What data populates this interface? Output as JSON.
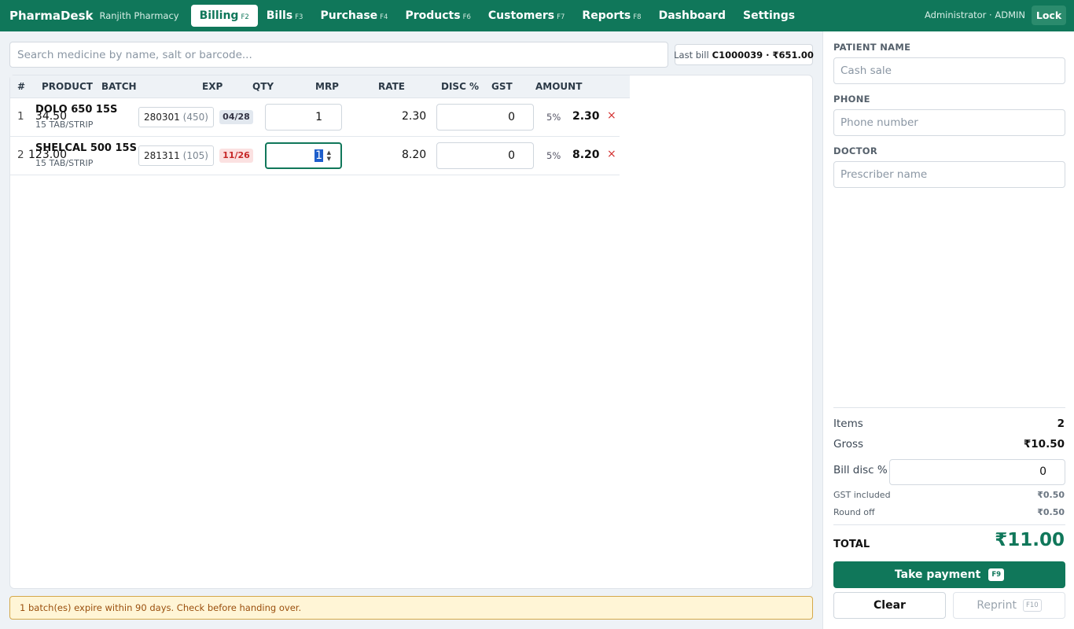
{
  "app": {
    "name": "PharmaDesk",
    "shop": "Ranjith Pharmacy"
  },
  "nav": [
    {
      "label": "Billing",
      "key": "F2"
    },
    {
      "label": "Bills",
      "key": "F3"
    },
    {
      "label": "Purchase",
      "key": "F4"
    },
    {
      "label": "Products",
      "key": "F6"
    },
    {
      "label": "Customers",
      "key": "F7"
    },
    {
      "label": "Reports",
      "key": "F8"
    },
    {
      "label": "Dashboard",
      "key": ""
    },
    {
      "label": "Settings",
      "key": ""
    }
  ],
  "user": "Administrator · ADMIN",
  "lock_label": "Lock",
  "search": {
    "placeholder": "Search medicine by name, salt or barcode..."
  },
  "last_bill": {
    "label": "Last bill",
    "value": "C1000039 · ₹651.00"
  },
  "table": {
    "headers": {
      "num": "#",
      "product": "PRODUCT",
      "batch": "BATCH",
      "exp": "EXP",
      "qty": "QTY",
      "mrp": "MRP",
      "rate": "RATE",
      "disc": "DISC %",
      "gst": "GST",
      "amount": "AMOUNT"
    },
    "rows": [
      {
        "num": "1",
        "product": "DOLO 650 15S",
        "pack": "15 TAB/STRIP",
        "batch": "280301",
        "stock": "(450)",
        "exp": "04/28",
        "qty": "1",
        "mrp": "34.50",
        "rate": "2.30",
        "disc": "0",
        "gst": "5%",
        "amount": "2.30",
        "delete": "×"
      },
      {
        "num": "2",
        "product": "SHELCAL 500 15S",
        "pack": "15 TAB/STRIP",
        "batch": "281311",
        "stock": "(105)",
        "exp": "11/26",
        "qty": "1",
        "mrp": "123.00",
        "rate": "8.20",
        "disc": "0",
        "gst": "5%",
        "amount": "8.20",
        "delete": "×"
      }
    ]
  },
  "alert": "1 batch(es) expire within 90 days. Check before handing over.",
  "patient": {
    "name_label": "PATIENT NAME",
    "name_placeholder": "Cash sale",
    "phone_label": "PHONE",
    "phone_placeholder": "Phone number",
    "doctor_label": "DOCTOR",
    "doctor_placeholder": "Prescriber name"
  },
  "summary": {
    "items_label": "Items",
    "items": "2",
    "gross_label": "Gross",
    "gross": "₹10.50",
    "bill_disc_label": "Bill disc %",
    "bill_disc": "0",
    "gst_label": "GST included",
    "gst": "₹0.50",
    "round_label": "Round off",
    "round": "₹0.50",
    "total_label": "TOTAL",
    "total": "₹11.00"
  },
  "actions": {
    "pay_label": "Take payment",
    "pay_key": "F9",
    "clear_label": "Clear",
    "reprint_label": "Reprint",
    "reprint_key": "F10"
  },
  "colors": {
    "brand": "#10775a",
    "danger": "#d32f2f",
    "warning_bg": "#fff5d6"
  }
}
